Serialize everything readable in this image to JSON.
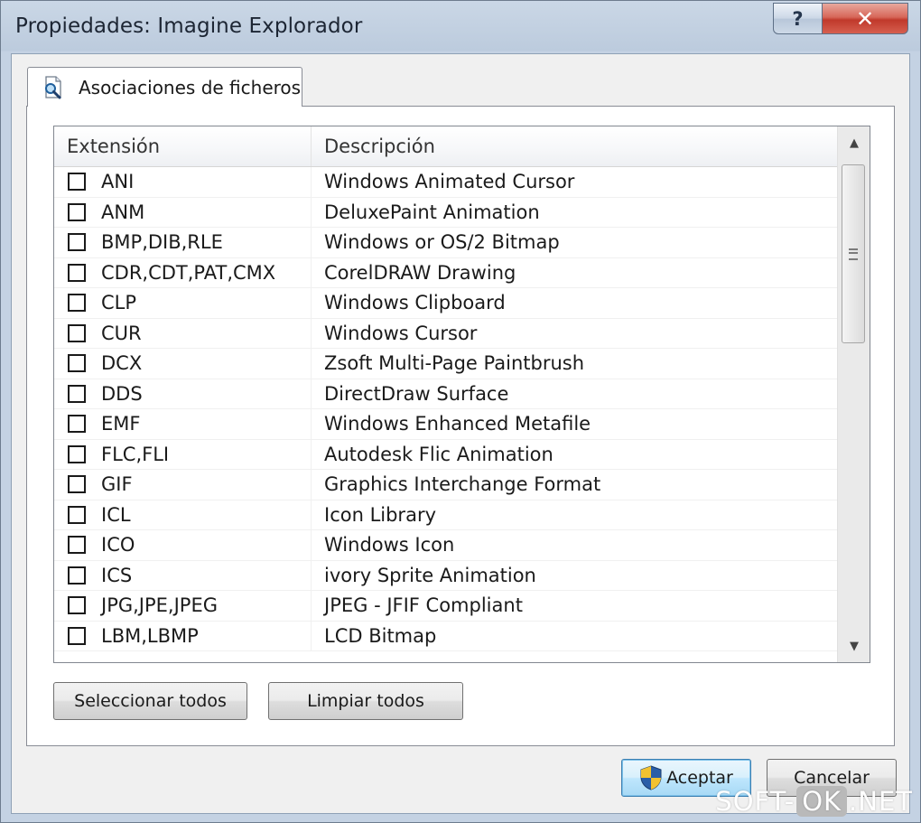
{
  "window": {
    "title": "Propiedades: Imagine Explorador",
    "help_label": "?",
    "close_label": "✕"
  },
  "tab": {
    "label": "Asociaciones de ficheros",
    "icon": "file-search-icon"
  },
  "list": {
    "columns": [
      "Extensión",
      "Descripción"
    ],
    "rows": [
      {
        "ext": "ANI",
        "desc": "Windows Animated Cursor",
        "checked": false
      },
      {
        "ext": "ANM",
        "desc": "DeluxePaint Animation",
        "checked": false
      },
      {
        "ext": "BMP,DIB,RLE",
        "desc": "Windows or OS/2 Bitmap",
        "checked": false
      },
      {
        "ext": "CDR,CDT,PAT,CMX",
        "desc": "CorelDRAW Drawing",
        "checked": false
      },
      {
        "ext": "CLP",
        "desc": "Windows Clipboard",
        "checked": false
      },
      {
        "ext": "CUR",
        "desc": "Windows Cursor",
        "checked": false
      },
      {
        "ext": "DCX",
        "desc": "Zsoft Multi-Page Paintbrush",
        "checked": false
      },
      {
        "ext": "DDS",
        "desc": "DirectDraw Surface",
        "checked": false
      },
      {
        "ext": "EMF",
        "desc": "Windows Enhanced Metafile",
        "checked": false
      },
      {
        "ext": "FLC,FLI",
        "desc": "Autodesk Flic Animation",
        "checked": false
      },
      {
        "ext": "GIF",
        "desc": "Graphics Interchange Format",
        "checked": false
      },
      {
        "ext": "ICL",
        "desc": "Icon Library",
        "checked": false
      },
      {
        "ext": "ICO",
        "desc": "Windows Icon",
        "checked": false
      },
      {
        "ext": "ICS",
        "desc": "ivory Sprite Animation",
        "checked": false
      },
      {
        "ext": "JPG,JPE,JPEG",
        "desc": "JPEG - JFIF Compliant",
        "checked": false
      },
      {
        "ext": "LBM,LBMP",
        "desc": "LCD Bitmap",
        "checked": false
      }
    ]
  },
  "buttons": {
    "select_all": "Seleccionar todos",
    "clear_all": "Limpiar todos",
    "ok": "Aceptar",
    "cancel": "Cancelar"
  },
  "watermark": {
    "left": "SOFT-",
    "box": "OK",
    "right": ".NET"
  },
  "colors": {
    "window_frame": "#c4d2e3",
    "close_red": "#c0392b",
    "ok_blue": "#3c7fb1"
  }
}
